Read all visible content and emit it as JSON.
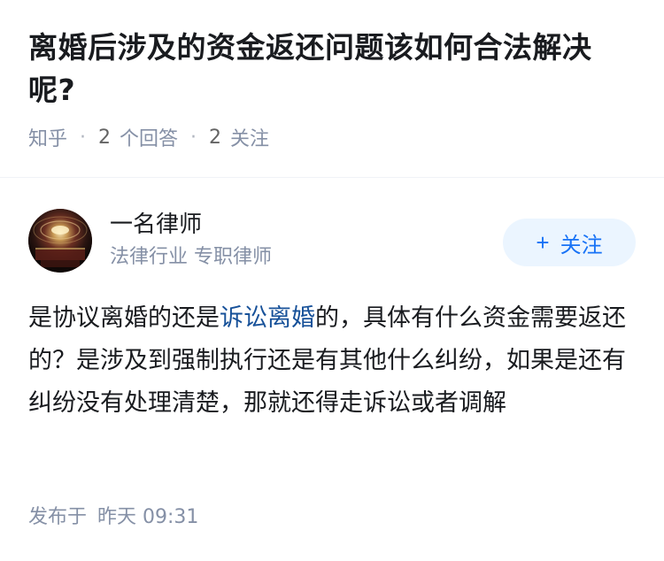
{
  "question": {
    "title": "离婚后涉及的资金返还问题该如何合法解决呢?",
    "source": "知乎",
    "answer_count": "2",
    "answer_label": "个回答",
    "follow_count": "2",
    "follow_label": "关注"
  },
  "answer": {
    "author": {
      "name": "一名律师",
      "description": "法律行业 专职律师",
      "avatar_icon": "avatar-image"
    },
    "follow_button": {
      "icon": "+",
      "label": "关注"
    },
    "content": {
      "before_link": "是协议离婚的还是",
      "link_text": "诉讼离婚",
      "after_link": "的，具体有什么资金需要返还的？是涉及到强制执行还是有其他什么纠纷，如果是还有纠纷没有处理清楚，那就还得走诉讼或者调解"
    },
    "publish": {
      "label": "发布于",
      "time": "昨天 09:31"
    }
  },
  "colors": {
    "link": "#175199",
    "accent": "#1772f6",
    "follow_bg": "#ebf5ff",
    "meta": "#8590a6"
  }
}
